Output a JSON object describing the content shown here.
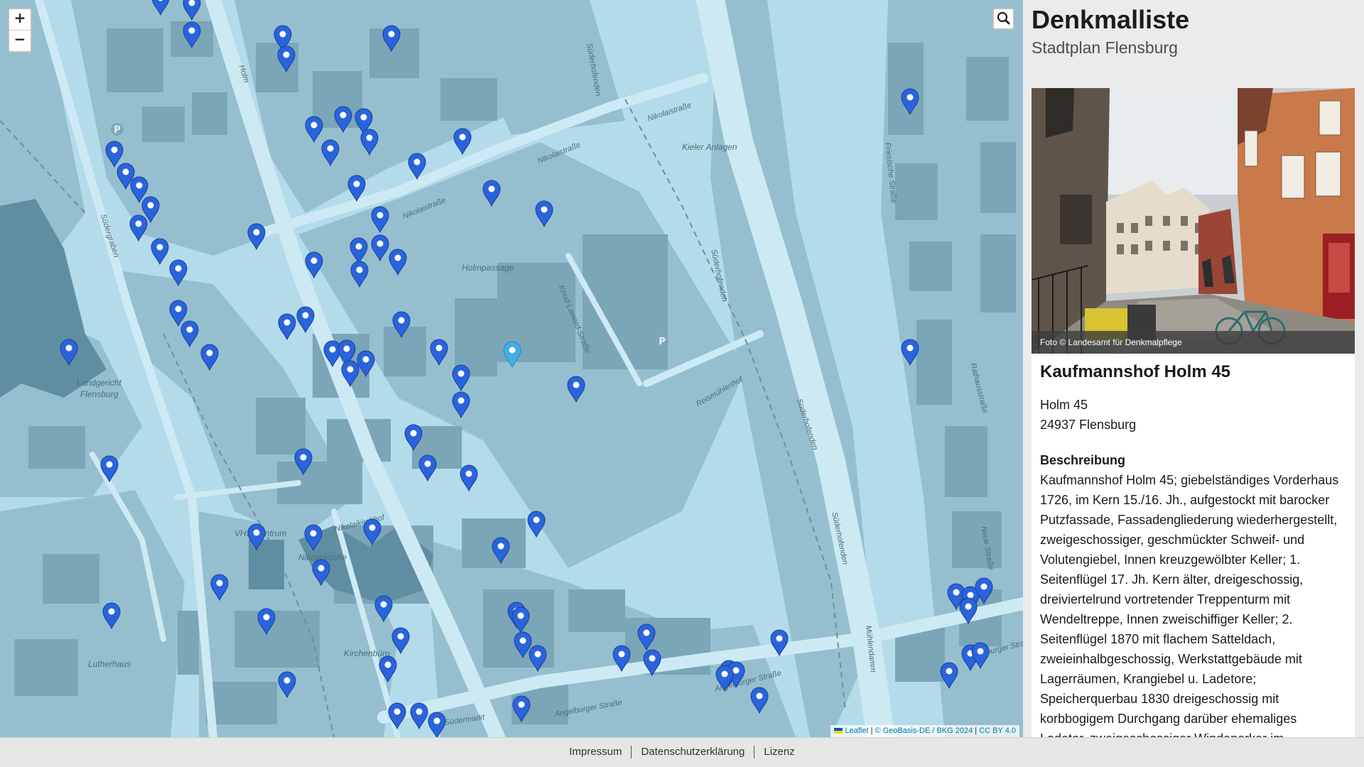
{
  "app": {
    "title": "Denkmalliste",
    "subtitle": "Stadtplan Flensburg"
  },
  "map": {
    "zoom_in_label": "+",
    "zoom_out_label": "−",
    "search_icon": "magnifier-icon",
    "attribution": {
      "leaflet": "Leaflet",
      "separator": " | ",
      "source": "© GeoBasis-DE / BKG 2024",
      "license": "CC BY 4.0"
    },
    "labels": {
      "holmpassage": "Holmpassage",
      "kieler_anlagen": "Kieler Anlagen",
      "landgericht": [
        "Landgericht",
        "Flensburg"
      ],
      "vhs": "VHS-Zentrum",
      "nikolaikirche": "Nikolaikirche",
      "kirchenbuero": "Kirchenbüro",
      "lutherhaus": "Lutherhaus",
      "nikolaistrasse": "Nikolaistraße",
      "nikolaikirchhof": "Nikolaikirchhof",
      "holm": "Holm",
      "suedergraben": "Südergraben",
      "knud_laward": "Knud-Laward-Straße",
      "reismuehlenhof": "Reismühlenhof",
      "suederhofenden": "Süderhofenden",
      "angelburger": "Angelburger Straße",
      "suedermarkt": "Südermarkt",
      "friesische": "Friesische Straße",
      "rathausstrasse": "Rathausstraße",
      "neue_strasse": "Neue Straße",
      "muehlendamm": "Mühlendamm"
    },
    "colors": {
      "marker": "#2a64dc",
      "marker_selected": "#42aee8",
      "water": "#b4dbea",
      "block": "#8fb8c8",
      "building": "#6f9cae"
    }
  },
  "detail": {
    "photo_caption": "Foto © Landesamt für Denkmalpflege",
    "name": "Kaufmannshof Holm 45",
    "address_line1": "Holm 45",
    "address_line2": "24937 Flensburg",
    "description_heading": "Beschreibung",
    "description": "Kaufmannshof Holm 45; giebelständiges Vorderhaus 1726, im Kern 15./16. Jh., aufgestockt mit barocker Putzfassade, Fassadengliederung wiederhergestellt, zweigeschossiger, geschmückter Schweif- und Volutengiebel, Innen kreuzgewölbter Keller; 1. Seitenflügel 17. Jh. Kern älter, dreigeschossig, dreiviertelrund vortretender Treppenturm mit Wendeltreppe, Innen zweischiffiger Keller; 2. Seitenflügel 1870 mit flachem Satteldach, zweieinhalbgeschossig, Werkstattgebäude mit Lagerräumen, Krangiebel u. Ladetore; Speicherquerbau 1830 dreigeschossig mit korbbogigem Durchgang darüber ehemaliges Ladetor, zweigeschossiger Windenerker im"
  },
  "footer": {
    "links": [
      "Impressum",
      "Datenschutzerklärung",
      "Lizenz"
    ]
  }
}
